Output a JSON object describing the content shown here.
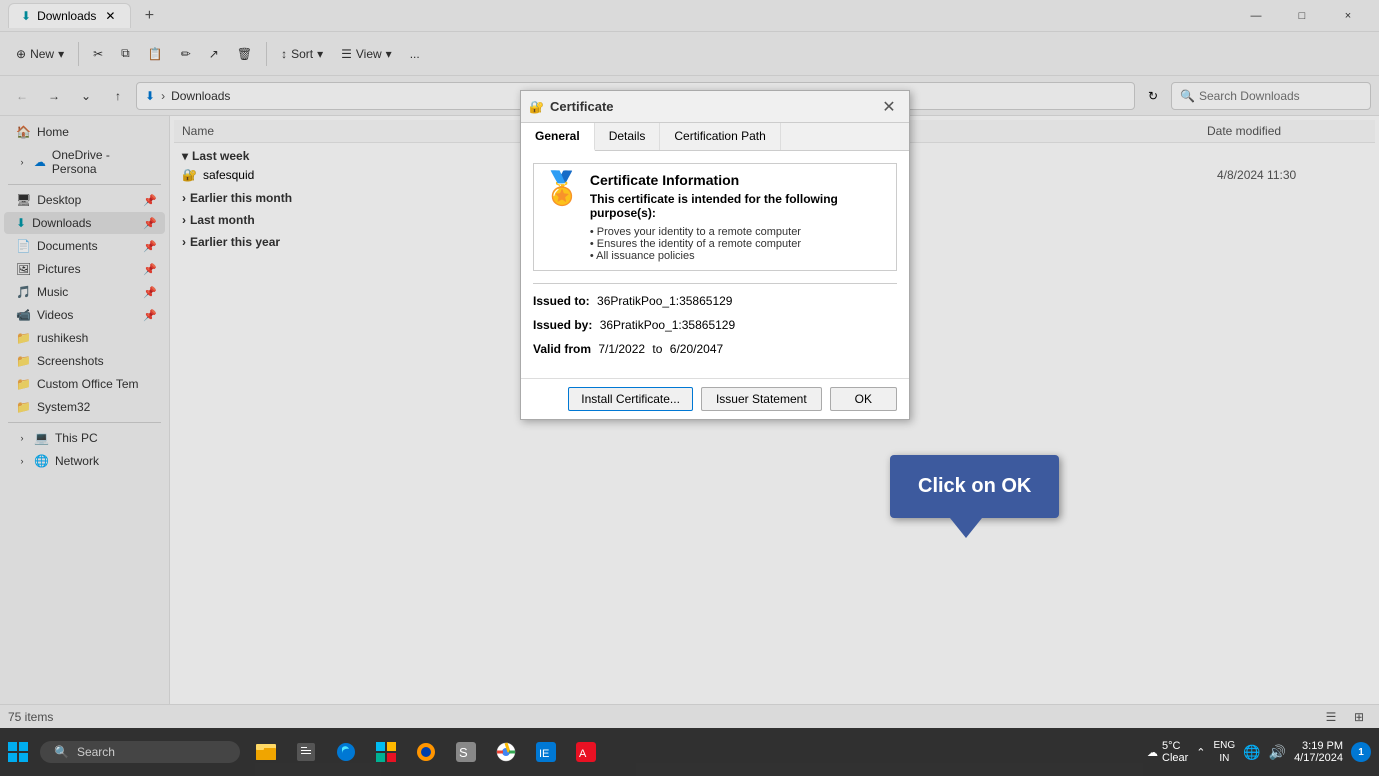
{
  "window": {
    "title": "Downloads",
    "tab_label": "Downloads",
    "close_label": "×",
    "minimize_label": "—",
    "maximize_label": "□"
  },
  "toolbar": {
    "new_label": "New",
    "cut_label": "Cut",
    "copy_label": "Copy",
    "paste_label": "Paste",
    "rename_label": "Rename",
    "delete_label": "Delete",
    "sort_label": "Sort",
    "view_label": "View",
    "more_label": "..."
  },
  "address_bar": {
    "path": "Downloads",
    "search_placeholder": "Search Downloads"
  },
  "sidebar": {
    "items": [
      {
        "label": "Home",
        "icon": "home",
        "expanded": false
      },
      {
        "label": "OneDrive - Persona",
        "icon": "cloud",
        "expanded": false
      },
      {
        "label": "Desktop",
        "icon": "desktop",
        "pinned": true
      },
      {
        "label": "Downloads",
        "icon": "download",
        "pinned": true,
        "active": true
      },
      {
        "label": "Documents",
        "icon": "document",
        "pinned": true
      },
      {
        "label": "Pictures",
        "icon": "pictures",
        "pinned": true
      },
      {
        "label": "Music",
        "icon": "music",
        "pinned": true
      },
      {
        "label": "Videos",
        "icon": "videos",
        "pinned": true
      },
      {
        "label": "rushikesh",
        "icon": "folder"
      },
      {
        "label": "Screenshots",
        "icon": "folder"
      },
      {
        "label": "Custom Office Tem",
        "icon": "folder"
      },
      {
        "label": "System32",
        "icon": "folder"
      },
      {
        "label": "This PC",
        "icon": "pc",
        "expandable": true
      },
      {
        "label": "Network",
        "icon": "network",
        "expandable": true
      }
    ]
  },
  "file_list": {
    "col_name": "Name",
    "col_date": "Date modified",
    "groups": [
      {
        "label": "Last week",
        "expanded": true,
        "files": [
          {
            "name": "safesquid",
            "date": "4/8/2024 11:30",
            "icon": "cert"
          }
        ]
      },
      {
        "label": "Earlier this month",
        "expanded": false,
        "files": []
      },
      {
        "label": "Last month",
        "expanded": false,
        "files": []
      },
      {
        "label": "Earlier this year",
        "expanded": false,
        "files": []
      }
    ]
  },
  "status_bar": {
    "item_count": "75 items"
  },
  "certificate_dialog": {
    "title": "Certificate",
    "tabs": [
      "General",
      "Details",
      "Certification Path"
    ],
    "active_tab": "General",
    "cert_info_title": "Certificate Information",
    "cert_purposes_label": "This certificate is intended for the following purpose(s):",
    "cert_bullets": [
      "Proves your identity to a remote computer",
      "Ensures the identity of a remote computer",
      "All issuance policies"
    ],
    "issued_to_label": "Issued to:",
    "issued_to_value": "36PratikPoo_1:35865129",
    "issued_by_label": "Issued by:",
    "issued_by_value": "36PratikPoo_1:35865129",
    "valid_label": "Valid from",
    "valid_from": "7/1/2022",
    "valid_to_label": "to",
    "valid_to": "6/20/2047",
    "install_btn": "Install Certificate...",
    "issuer_btn": "Issuer Statement",
    "ok_btn": "OK"
  },
  "callout": {
    "text": "Click on OK"
  },
  "taskbar": {
    "search_label": "Search",
    "language": "ENG\nIN",
    "time": "3:19 PM",
    "date": "4/17/2024",
    "temp": "5°C",
    "weather": "Clear"
  }
}
